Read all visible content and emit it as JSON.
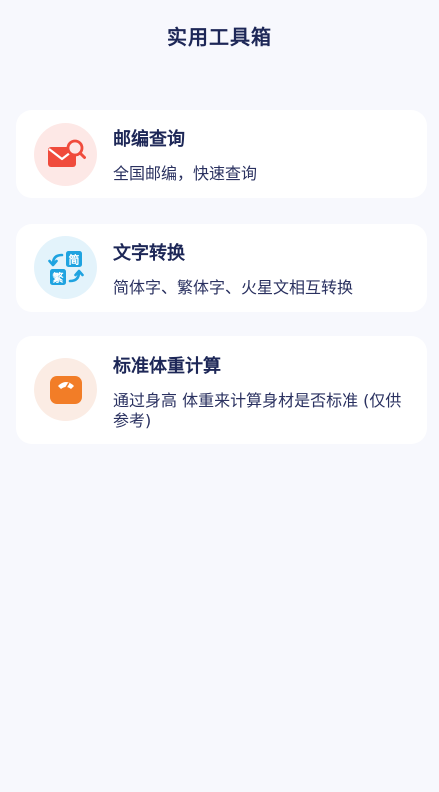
{
  "header": {
    "title": "实用工具箱"
  },
  "tools": [
    {
      "title": "邮编查询",
      "description": "全国邮编，快速查询",
      "icon": "mail-search-icon",
      "icon_color": "#f04b3c"
    },
    {
      "title": "文字转换",
      "description": "简体字、繁体字、火星文相互转换",
      "icon": "text-convert-icon",
      "icon_color": "#1fa3e0",
      "icon_labels": [
        "简",
        "繁"
      ]
    },
    {
      "title": "标准体重计算",
      "description": "通过身高 体重来计算身材是否标准 (仅供参考)",
      "icon": "scale-icon",
      "icon_color": "#f27d27"
    }
  ],
  "colors": {
    "background": "#f7f8fd",
    "card": "#ffffff",
    "title_text": "#1d2757"
  }
}
